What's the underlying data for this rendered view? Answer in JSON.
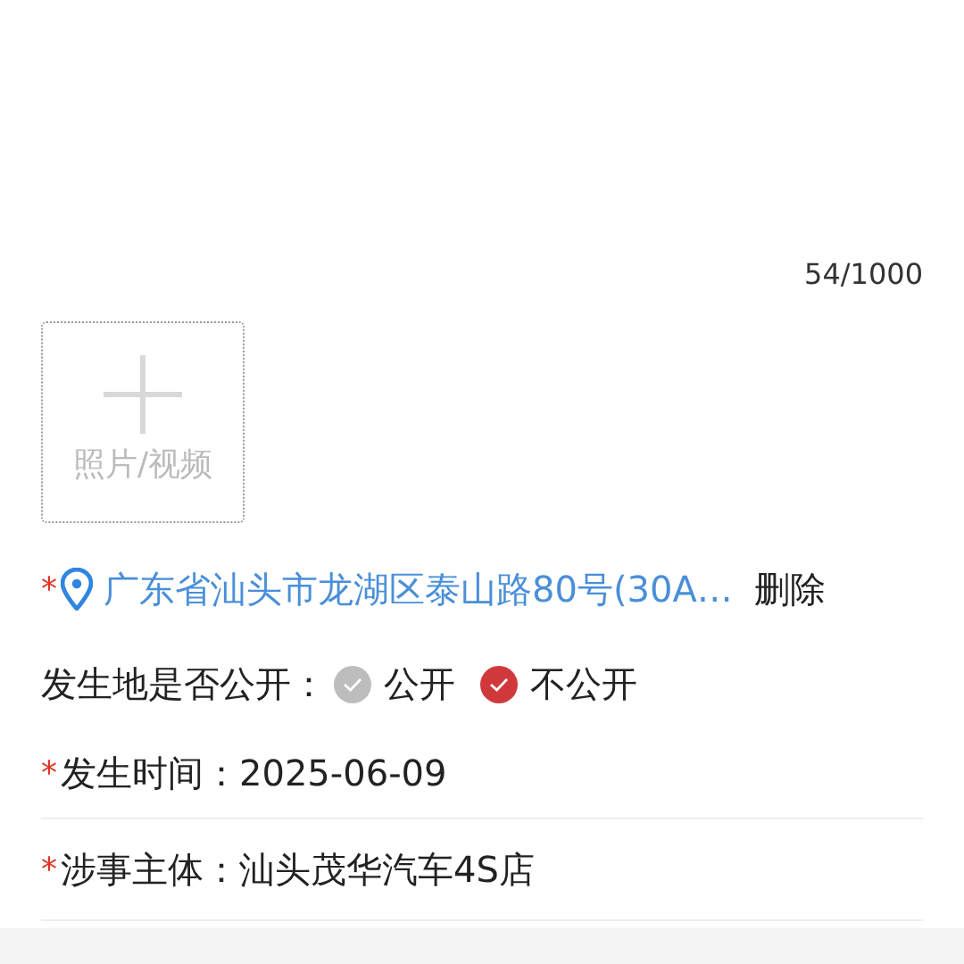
{
  "description": {
    "counter": "54/1000"
  },
  "upload": {
    "label": "照片/视频"
  },
  "location": {
    "required_mark": "*",
    "address": "广东省汕头市龙湖区泰山路80号(30A…",
    "action": "删除"
  },
  "visibility": {
    "label": "发生地是否公开：",
    "options": [
      {
        "label": "公开",
        "selected": false
      },
      {
        "label": "不公开",
        "selected": true
      }
    ]
  },
  "fields": [
    {
      "required_mark": "*",
      "label": "发生时间：",
      "value": "2025-06-09"
    },
    {
      "required_mark": "*",
      "label": "涉事主体：",
      "value": "汕头茂华汽车4S店"
    }
  ]
}
